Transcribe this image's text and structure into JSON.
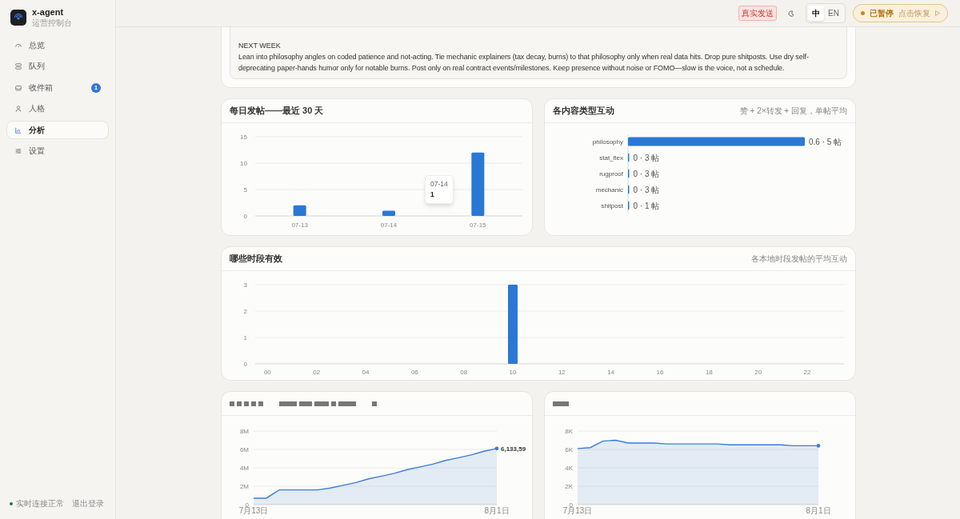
{
  "sidebar": {
    "app_name": "x-agent",
    "subtitle": "运营控制台",
    "nav": [
      {
        "label": "总览",
        "selected": false
      },
      {
        "label": "队列",
        "selected": false
      },
      {
        "label": "收件箱",
        "selected": false,
        "badge": "1"
      },
      {
        "label": "人格",
        "selected": false
      },
      {
        "label": "分析",
        "selected": true
      },
      {
        "label": "设置",
        "selected": false
      }
    ],
    "status": {
      "label": "实时连接正常",
      "online": true
    },
    "logout": "退出登录"
  },
  "header": {
    "mode_badge": "真实发送",
    "languages": [
      {
        "label": "中",
        "selected": true
      },
      {
        "label": "EN",
        "selected": false
      }
    ],
    "pause": {
      "label": "已暂停",
      "hint": "点击恢复"
    }
  },
  "plan_card": {
    "heading": "NEXT WEEK",
    "body": "Lean into philosophy angles on coded patience and not-acting. Tie mechanic explainers (tax decay, burns) to that philosophy only when real data hits. Drop pure shitposts. Use dry self-deprecating paper-hands humor only for notable burns. Post only on real contract events/milestones. Keep presence without noise or FOMO—slow is the voice, not a schedule."
  },
  "cards": [
    {
      "title": "每日发帖——最近 30 天",
      "tooltip": {
        "label": "07-14",
        "value": "1"
      },
      "chart_data": {
        "type": "bar",
        "categories": [
          "07-13",
          "07-14",
          "07-15"
        ],
        "values": [
          2,
          1,
          12
        ],
        "ylim": [
          0,
          15
        ],
        "yticks": [
          0,
          5,
          10,
          15
        ]
      }
    },
    {
      "title": "各内容类型互动",
      "subtitle": "赞 + 2×转发 + 回复，单帖平均",
      "chart_data": {
        "type": "bar",
        "orientation": "horizontal",
        "categories": [
          "philosophy",
          "stat_flex",
          "rugproof",
          "mechanic",
          "shitpost"
        ],
        "values": [
          0.6,
          0,
          0,
          0,
          0
        ],
        "xlim": [
          0,
          0.6
        ],
        "value_labels": [
          "0.6 · 5 帖",
          "0 · 3 帖",
          "0 · 3 帖",
          "0 · 3 帖",
          "0 · 1 帖"
        ]
      }
    },
    {
      "title": "哪些时段有效",
      "subtitle": "各本地时段发帖的平均互动",
      "wide": true,
      "chart_data": {
        "type": "bar",
        "x": [
          0,
          1,
          2,
          3,
          4,
          5,
          6,
          7,
          8,
          9,
          10,
          11,
          12,
          13,
          14,
          15,
          16,
          17,
          18,
          19,
          20,
          21,
          22,
          23
        ],
        "values": [
          0,
          0,
          0,
          0,
          0,
          0,
          0,
          0,
          0,
          0,
          3,
          0,
          0,
          0,
          0,
          0,
          0,
          0,
          0,
          0,
          0,
          0,
          0,
          0
        ],
        "xlim": [
          -0.5,
          23.5
        ],
        "ylim": [
          0,
          3
        ],
        "yticks": [
          0,
          1,
          2,
          3
        ],
        "xticks": [
          {
            "value": 0,
            "label": "00"
          },
          {
            "value": 2,
            "label": "02"
          },
          {
            "value": 4,
            "label": "04"
          },
          {
            "value": 6,
            "label": "06"
          },
          {
            "value": 8,
            "label": "08"
          },
          {
            "value": 10,
            "label": "10"
          },
          {
            "value": 12,
            "label": "12"
          },
          {
            "value": 14,
            "label": "14"
          },
          {
            "value": 16,
            "label": "16"
          },
          {
            "value": 18,
            "label": "18"
          },
          {
            "value": 20,
            "label": "20"
          },
          {
            "value": 22,
            "label": "22"
          }
        ]
      }
    },
    {
      "redacted_title": true,
      "chart_data": {
        "type": "area",
        "categories": [
          "7月13日",
          null,
          null,
          null,
          null,
          null,
          null,
          null,
          null,
          null,
          null,
          null,
          null,
          null,
          null,
          null,
          null,
          null,
          null,
          "8月1日"
        ],
        "grid": true,
        "series": [
          {
            "color": "#3b7dd8",
            "values": [
              700000,
              700000,
              1600000,
              1600000,
              1600000,
              1600000,
              1800000,
              2100000,
              2400000,
              2800000,
              3100000,
              3400000,
              3800000,
              4100000,
              4400000,
              4800000,
              5100000,
              5400000,
              5800000,
              6100000
            ]
          }
        ],
        "ylim": [
          0,
          8000000
        ],
        "yticks": [
          {
            "value": 0,
            "label": "0"
          },
          {
            "value": 2000000,
            "label": "2M"
          },
          {
            "value": 4000000,
            "label": "4M"
          },
          {
            "value": 6000000,
            "label": "6M"
          },
          {
            "value": 8000000,
            "label": "8M"
          }
        ],
        "annotations": [
          {
            "x": "8月1日",
            "y": 6100000,
            "text": "6,133,59"
          }
        ]
      }
    },
    {
      "redacted_title": true,
      "chart_data": {
        "type": "area",
        "categories": [
          "7月13日",
          null,
          null,
          null,
          null,
          null,
          null,
          null,
          null,
          null,
          null,
          null,
          null,
          null,
          null,
          null,
          null,
          null,
          null,
          "8月1日"
        ],
        "grid": true,
        "series": [
          {
            "color": "#3b7dd8",
            "values": [
              6100,
              6200,
              6900,
              7000,
              6700,
              6700,
              6700,
              6600,
              6600,
              6600,
              6600,
              6600,
              6500,
              6500,
              6500,
              6500,
              6500,
              6400,
              6400,
              6400
            ]
          }
        ],
        "ylim": [
          0,
          8000
        ],
        "yticks": [
          {
            "value": 0,
            "label": "0"
          },
          {
            "value": 2000,
            "label": "2K"
          },
          {
            "value": 4000,
            "label": "4K"
          },
          {
            "value": 6000,
            "label": "6K"
          },
          {
            "value": 8000,
            "label": "8K"
          }
        ]
      }
    }
  ]
}
